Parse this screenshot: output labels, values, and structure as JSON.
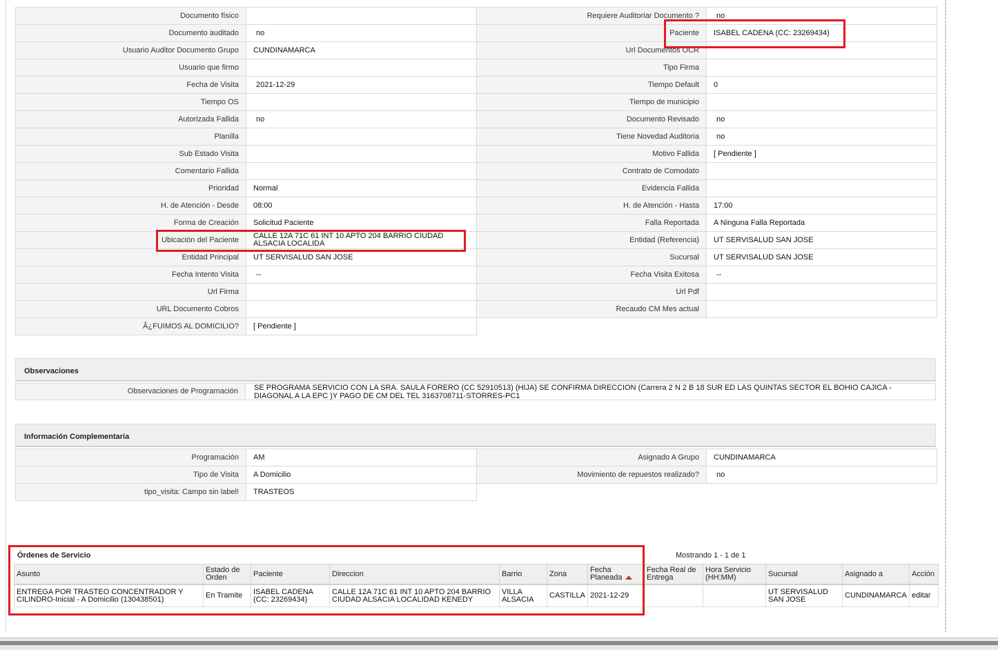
{
  "left_rows": [
    {
      "label": "Documento físico",
      "value": ""
    },
    {
      "label": "Documento auditado",
      "value": "no"
    },
    {
      "label": "Usuario Auditor Documento Grupo",
      "value": "CUNDINAMARCA"
    },
    {
      "label": "Usuario que firmo",
      "value": ""
    },
    {
      "label": "Fecha de Visita",
      "value": "2021-12-29"
    },
    {
      "label": "Tiempo OS",
      "value": ""
    },
    {
      "label": "Autorizada Fallida",
      "value": "no"
    },
    {
      "label": "Planilla",
      "value": ""
    },
    {
      "label": "Sub Estado Visita",
      "value": ""
    },
    {
      "label": "Comentario Fallida",
      "value": ""
    },
    {
      "label": "Prioridad",
      "value": "Normal"
    },
    {
      "label": "H. de Atención - Desde",
      "value": "08:00"
    },
    {
      "label": "Forma de Creación",
      "value": "Solicitud Paciente"
    },
    {
      "label": "Ubicación del Paciente",
      "value": "CALLE 12A 71C 61 INT 10 APTO 204 BARRIO CIUDAD ALSACIA LOCALIDA"
    },
    {
      "label": "Entidad Principal",
      "value": "UT SERVISALUD SAN JOSE"
    },
    {
      "label": "Fecha Intento Visita",
      "value": "--"
    },
    {
      "label": "Url Firma",
      "value": ""
    },
    {
      "label": "URL Documento Cobros",
      "value": ""
    },
    {
      "label": "Â¿FUIMOS AL DOMICILIO?",
      "value": "[ Pendiente ]"
    }
  ],
  "right_rows": [
    {
      "label": "Requiere Auditoriar Documento ?",
      "value": "no"
    },
    {
      "label": "Paciente",
      "value": "ISABEL CADENA (CC: 23269434)"
    },
    {
      "label": "Url Documentos OCR",
      "value": ""
    },
    {
      "label": "Tipo Firma",
      "value": ""
    },
    {
      "label": "Tiempo Default",
      "value": "0"
    },
    {
      "label": "Tiempo de municipio",
      "value": ""
    },
    {
      "label": "Documento Revisado",
      "value": "no"
    },
    {
      "label": "Tiene Novedad Auditoria",
      "value": "no"
    },
    {
      "label": "Motivo Fallida",
      "value": "[ Pendiente ]"
    },
    {
      "label": "Contrato de Comodato",
      "value": ""
    },
    {
      "label": "Evidencia Fallida",
      "value": ""
    },
    {
      "label": "H. de Atención - Hasta",
      "value": "17:00"
    },
    {
      "label": "Falla Reportada",
      "value": "A Ninguna Falla Reportada"
    },
    {
      "label": "Entidad (Referencia)",
      "value": "UT SERVISALUD SAN JOSE"
    },
    {
      "label": "Sucursal",
      "value": "UT SERVISALUD SAN JOSE"
    },
    {
      "label": "Fecha Visita Exitosa",
      "value": "--"
    },
    {
      "label": "Url Pdf",
      "value": ""
    },
    {
      "label": "Recaudo CM Mes actual",
      "value": ""
    }
  ],
  "observaciones": {
    "title": "Observaciones",
    "label": "Observaciones de Programación",
    "value": "SE PROGRAMA SERVICIO CON LA SRA. SAULA FORERO (CC 52910513) (HIJA) SE CONFIRMA DIRECCION (Carrera 2 N 2 B 18 SUR ED LAS QUINTAS SECTOR EL BOHIO CAJICA - DIAGONAL A LA EPC )Y PAGO DE CM DEL TEL 3163708711-STORRES-PC1"
  },
  "complementaria": {
    "title": "Información Complementaria",
    "left": [
      {
        "label": "Programación",
        "value": "AM"
      },
      {
        "label": "Tipo de Visita",
        "value": "A Domicilio"
      },
      {
        "label": "tipo_visita: Campo sin label!",
        "value": "TRASTEOS"
      }
    ],
    "right": [
      {
        "label": "Asignado A Grupo",
        "value": "CUNDINAMARCA"
      },
      {
        "label": "Movimiento de repuestos realizado?",
        "value": "no"
      }
    ]
  },
  "ordenes": {
    "title": "Órdenes de Servicio",
    "showing": "Mostrando 1 - 1 de 1",
    "columns": [
      "Asunto",
      "Estado de Orden",
      "Paciente",
      "Direccion",
      "Barrio",
      "Zona",
      "Fecha Planeada",
      "Fecha Real de Entrega",
      "Hora Servicio (HH:MM)",
      "Sucursal",
      "Asignado a",
      "Acción"
    ],
    "rows": [
      [
        "ENTREGA POR TRASTEO CONCENTRADOR Y CILINDRO-Inicial - A Domicilio (130438501)",
        "En Tramite",
        "ISABEL CADENA (CC: 23269434)",
        "CALLE 12A 71C 61 INT 10 APTO 204 BARRIO CIUDAD ALSACIA LOCALIDAD KENEDY",
        "VILLA ALSACIA",
        "CASTILLA",
        "2021-12-29",
        "",
        "",
        "UT SERVISALUD SAN JOSE",
        "CUNDINAMARCA",
        "editar"
      ]
    ]
  },
  "colors": {
    "highlight": "#e11b22",
    "label_bg": "#f4f4f4",
    "sort_arrow": "#c0392b"
  }
}
